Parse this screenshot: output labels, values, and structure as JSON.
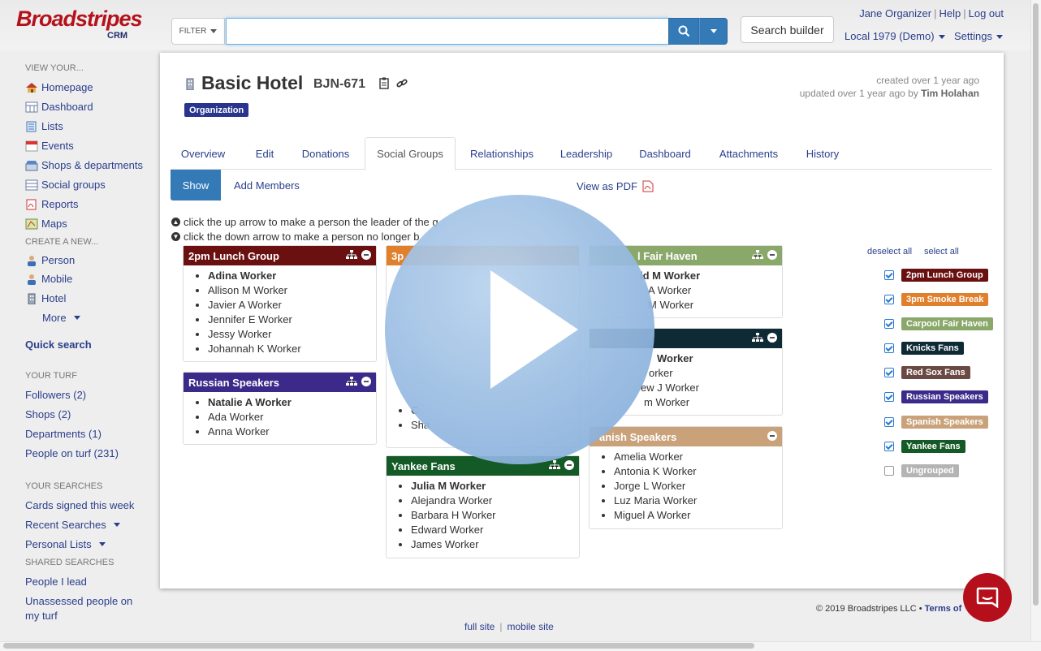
{
  "logo": {
    "brand": "Broadstripes",
    "sub": "CRM"
  },
  "header": {
    "filter_label": "FILTER",
    "search_value": "",
    "search_builder": "Search builder",
    "user": "Jane Organizer",
    "help": "Help",
    "logout": "Log out",
    "local": "Local 1979 (Demo)",
    "settings": "Settings"
  },
  "sidebar": {
    "view_heading": "VIEW YOUR...",
    "view_items": [
      {
        "label": "Homepage",
        "icon": "home-icon"
      },
      {
        "label": "Dashboard",
        "icon": "dashboard-icon"
      },
      {
        "label": "Lists",
        "icon": "list-icon"
      },
      {
        "label": "Events",
        "icon": "calendar-icon"
      },
      {
        "label": "Shops & departments",
        "icon": "shop-icon"
      },
      {
        "label": "Social groups",
        "icon": "group-icon"
      },
      {
        "label": "Reports",
        "icon": "pdf-report-icon"
      },
      {
        "label": "Maps",
        "icon": "map-icon"
      }
    ],
    "create_heading": "CREATE A NEW...",
    "create_items": [
      {
        "label": "Person",
        "icon": "person-icon"
      },
      {
        "label": "Mobile",
        "icon": "person-icon"
      },
      {
        "label": "Hotel",
        "icon": "building-icon"
      }
    ],
    "more": "More",
    "quick_search": "Quick search",
    "turf_heading": "YOUR TURF",
    "turf_items": [
      "Followers (2)",
      "Shops (2)",
      "Departments (1)",
      "People on turf (231)"
    ],
    "searches_heading": "YOUR SEARCHES",
    "cards_signed": "Cards signed this week",
    "recent_searches": "Recent Searches",
    "personal_lists": "Personal Lists",
    "shared_heading": "SHARED SEARCHES",
    "shared_items": [
      "People I lead",
      "Unassessed people on",
      "my turf"
    ]
  },
  "record": {
    "title": "Basic Hotel",
    "code": "BJN-671",
    "badge": "Organization",
    "created": "created over 1 year ago",
    "updated_prefix": "updated over 1 year ago by",
    "updated_by": "Tim Holahan"
  },
  "tabs": [
    "Overview",
    "Edit",
    "Donations",
    "Social Groups",
    "Relationships",
    "Leadership",
    "Dashboard",
    "Attachments",
    "History"
  ],
  "active_tab": "Social Groups",
  "actions": {
    "show": "Show",
    "add_members": "Add Members",
    "pdf": "View as PDF"
  },
  "hints": [
    "click the up arrow to make a person the leader of the g",
    "click the down arrow to make a person no longer b"
  ],
  "groups": [
    {
      "name": "2pm Lunch Group",
      "color": "#6b1010",
      "members": [
        "Adina Worker",
        "Allison M Worker",
        "Javier A Worker",
        "Jennifer E Worker",
        "Jessy Worker",
        "Johannah K Worker"
      ],
      "leader": "Adina Worker"
    },
    {
      "name": "Russian Speakers",
      "color": "#3b2a8a",
      "members": [
        "Natalie A Worker",
        "Ada Worker",
        "Anna Worker"
      ],
      "leader": "Natalie A Worker"
    },
    {
      "name": "3pm Smoke Break",
      "color": "#e07f2c",
      "members": [],
      "leader": ""
    },
    {
      "name": "Yankee Fans",
      "color": "#145a27",
      "members": [
        "Julia M Worker",
        "Alejandra Worker",
        "Barbara H Worker",
        "Edward Worker",
        "James Worker"
      ],
      "leader": "Julia M Worker"
    },
    {
      "name": "Carpool Fair Haven",
      "color": "#8aa86a",
      "members": [
        "Donald M Worker",
        "Ana Worker",
        "Sam M Worker"
      ],
      "leader": "Donald M Worker"
    },
    {
      "name": "Knicks Fans",
      "color": "#0e2a35",
      "members": [
        "Tom Worker",
        "Lisa Worker",
        "Andrew J Worker",
        "Miriam Worker"
      ],
      "leader": "Tom Worker"
    },
    {
      "name": "Spanish Speakers",
      "color": "#c9a27a",
      "members": [
        "Amelia Worker",
        "Antonia K Worker",
        "Jorge L Worker",
        "Luz Maria Worker",
        "Miguel A Worker"
      ],
      "leader": ""
    }
  ],
  "visible_fragments": {
    "carpool_header": "l Fair Haven",
    "carpool_members": [
      "ld M Worker",
      "A Worker",
      "M Worker"
    ],
    "knicks_members": [
      "Worker",
      "orker",
      "ew J Worker",
      "m Worker"
    ],
    "spanish_header": "anish Speakers",
    "smoke_header": "3p",
    "smoke_members": [
      "C",
      "Sha"
    ]
  },
  "filters": {
    "deselect_all": "deselect all",
    "select_all": "select all",
    "items": [
      {
        "label": "2pm Lunch Group",
        "color": "#6b1010",
        "checked": true
      },
      {
        "label": "3pm Smoke Break",
        "color": "#e07f2c",
        "checked": true
      },
      {
        "label": "Carpool Fair Haven",
        "color": "#8aa86a",
        "checked": true
      },
      {
        "label": "Knicks Fans",
        "color": "#0e2a35",
        "checked": true
      },
      {
        "label": "Red Sox Fans",
        "color": "#6b4a44",
        "checked": true
      },
      {
        "label": "Russian Speakers",
        "color": "#3b2a8a",
        "checked": true
      },
      {
        "label": "Spanish Speakers",
        "color": "#c9a27a",
        "checked": true
      },
      {
        "label": "Yankee Fans",
        "color": "#145a27",
        "checked": true
      },
      {
        "label": "Ungrouped",
        "color": "#b4b4b4",
        "checked": false
      }
    ]
  },
  "footer": {
    "copyright": "© 2019 Broadstripes LLC •",
    "terms": "Terms of",
    "full_site": "full site",
    "mobile_site": "mobile site"
  }
}
